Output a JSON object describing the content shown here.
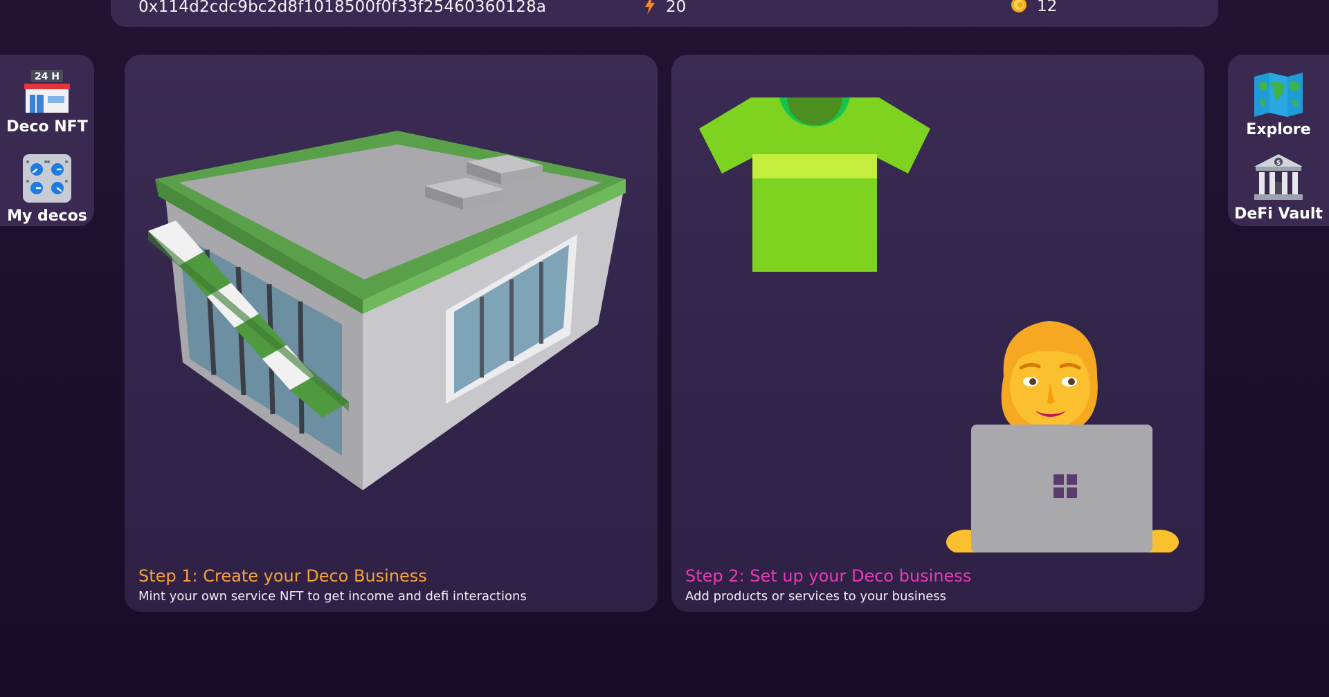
{
  "topbar": {
    "wallet_address": "0x114d2cdc9bc2d8f1018500f0f33f25460360128a",
    "energy": "20",
    "coins": "12",
    "energy_icon": "lightning-icon",
    "coin_icon": "coin-icon"
  },
  "left_dock": {
    "items": [
      {
        "label": "Deco NFT",
        "icon": "store-24h-icon",
        "badge": "24 H"
      },
      {
        "label": "My decos",
        "icon": "control-knobs-icon"
      }
    ]
  },
  "right_dock": {
    "items": [
      {
        "label": "Explore",
        "icon": "world-map-icon"
      },
      {
        "label": "DeFi Vault",
        "icon": "bank-icon"
      }
    ]
  },
  "cards": [
    {
      "title": "Step 1: Create your Deco Business",
      "description": "Mint your own service NFT to get income and defi interactions",
      "illustration": "store-building",
      "title_color": "#f7a23b"
    },
    {
      "title": "Step 2: Set up your Deco business",
      "description": "Add products or services to your business",
      "illustration": "tshirt-and-woman-with-laptop",
      "title_color": "#e83ab8"
    }
  ],
  "colors": {
    "background": "#1b0f2c",
    "panel": "#3a2a52",
    "card": "#36274e"
  }
}
